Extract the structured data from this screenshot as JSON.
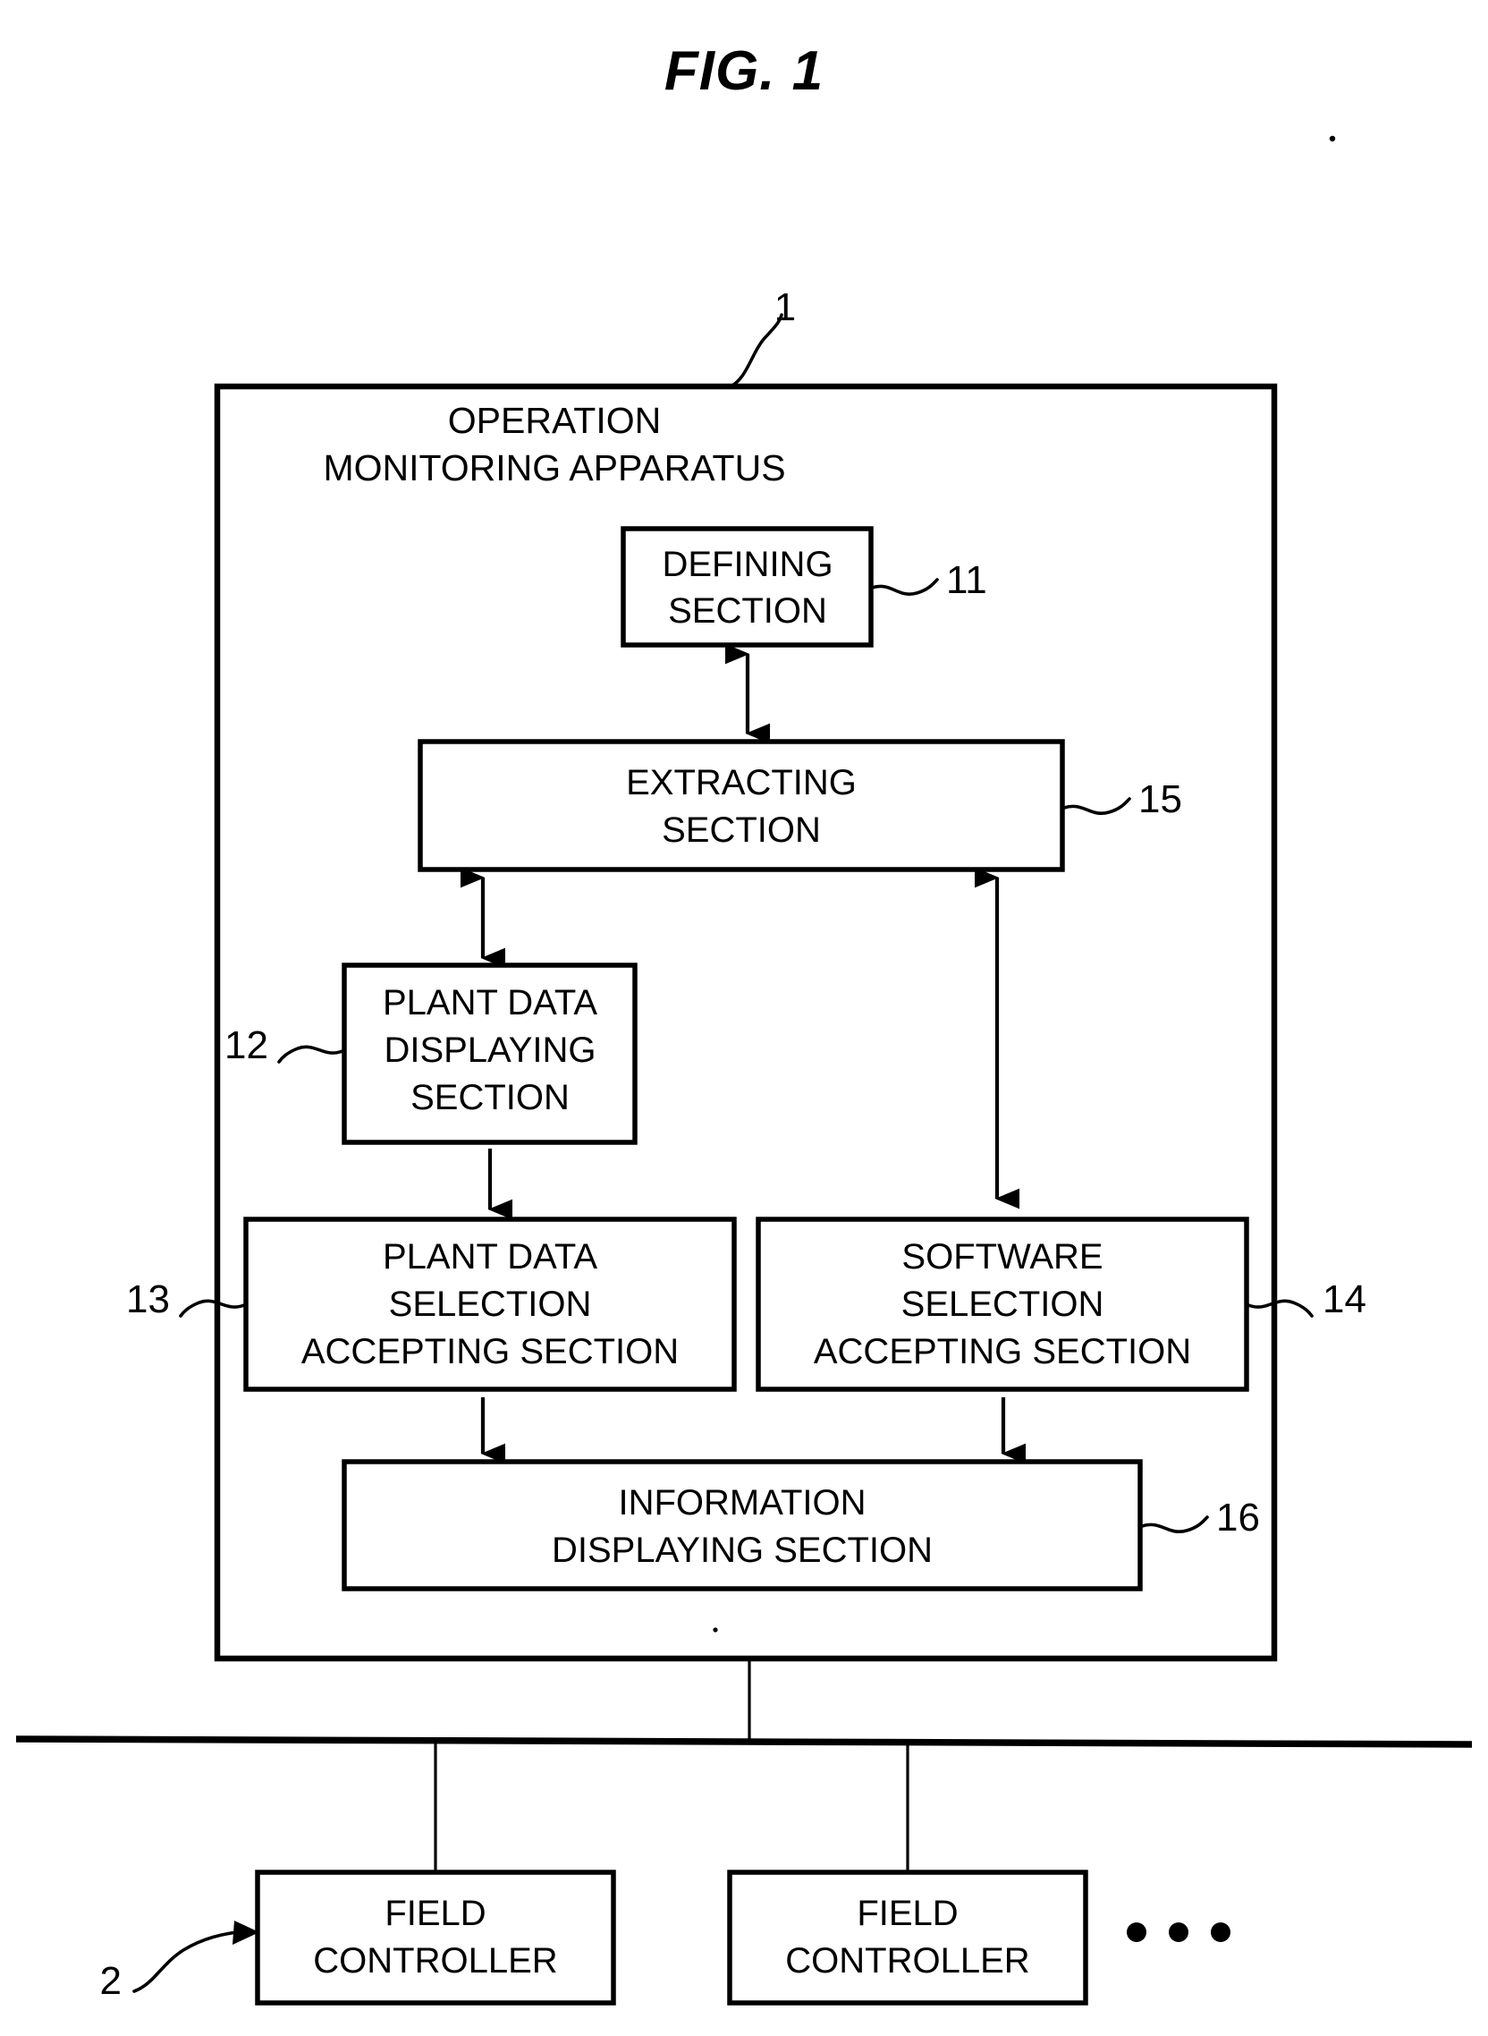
{
  "figure": {
    "title": "FIG. 1",
    "background_color": "#ffffff",
    "line_color": "#000000"
  },
  "main_container": {
    "ref": "1",
    "title_line1": "OPERATION",
    "title_line2": "MONITORING APPARATUS"
  },
  "blocks": [
    {
      "id": "defining",
      "ref": "11",
      "ref_side": "right",
      "lines": [
        "DEFINING",
        "SECTION"
      ]
    },
    {
      "id": "extracting",
      "ref": "15",
      "ref_side": "right",
      "lines": [
        "EXTRACTING",
        "SECTION"
      ]
    },
    {
      "id": "plant-data-displaying",
      "ref": "12",
      "ref_side": "left",
      "lines": [
        "PLANT DATA",
        "DISPLAYING",
        "SECTION"
      ]
    },
    {
      "id": "plant-data-selection-accepting",
      "ref": "13",
      "ref_side": "left",
      "lines": [
        "PLANT DATA",
        "SELECTION",
        "ACCEPTING SECTION"
      ]
    },
    {
      "id": "software-selection-accepting",
      "ref": "14",
      "ref_side": "right",
      "lines": [
        "SOFTWARE",
        "SELECTION",
        "ACCEPTING SECTION"
      ]
    },
    {
      "id": "information-displaying",
      "ref": "16",
      "ref_side": "right",
      "lines": [
        "INFORMATION",
        "DISPLAYING SECTION"
      ]
    }
  ],
  "field_controllers": {
    "ref": "2",
    "items": [
      {
        "lines": [
          "FIELD",
          "CONTROLLER"
        ]
      },
      {
        "lines": [
          "FIELD",
          "CONTROLLER"
        ]
      }
    ],
    "ellipsis": "• • •"
  },
  "icons": {
    "arrow_double": "double-headed-arrow-icon",
    "arrow_down": "down-arrow-icon",
    "leader_squiggle": "leader-line-icon",
    "ellipsis": "ellipsis-icon"
  }
}
